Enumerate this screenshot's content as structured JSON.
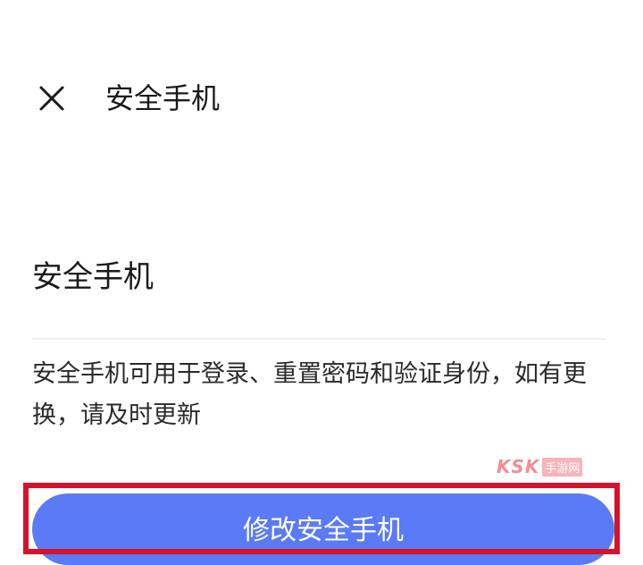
{
  "header": {
    "title": "安全手机",
    "close_icon": "close-icon"
  },
  "content": {
    "section_title": "安全手机",
    "description": "安全手机可用于登录、重置密码和验证身份，如有更换，请及时更新"
  },
  "watermark": {
    "logo_text": "KSK",
    "tag_text": "手游网"
  },
  "actions": {
    "primary_label": "修改安全手机"
  },
  "colors": {
    "button": "#5a7bf5",
    "highlight": "#d4142a",
    "watermark": "#e8343e"
  }
}
